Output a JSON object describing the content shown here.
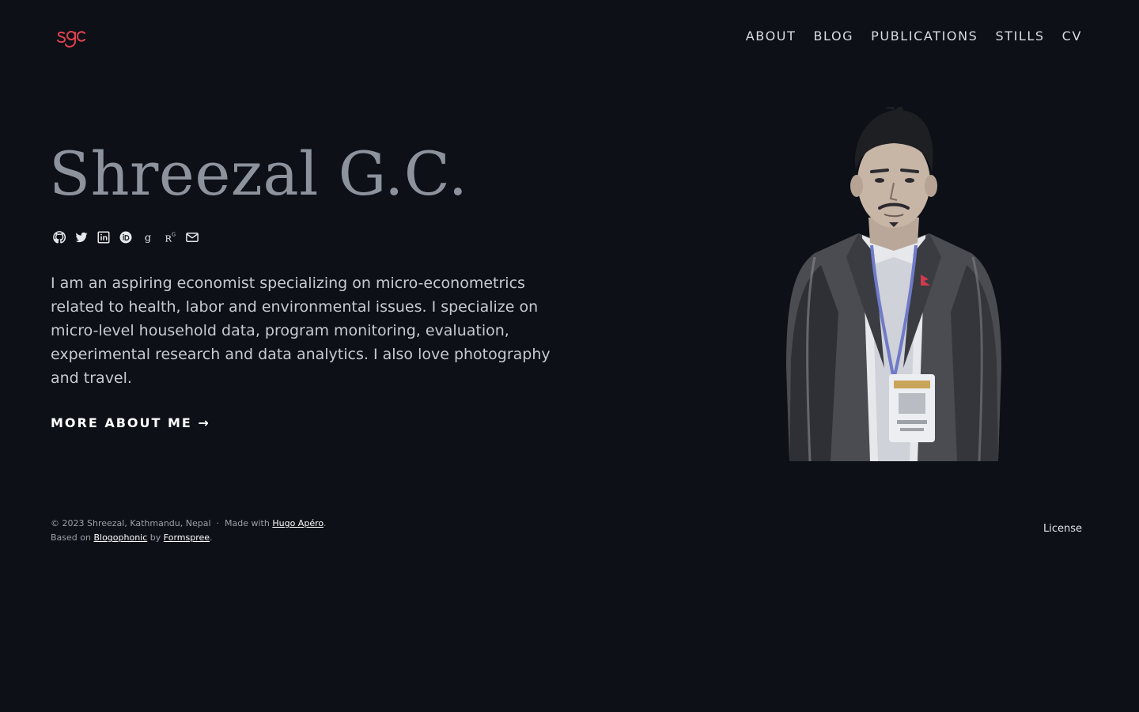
{
  "brand": {
    "logo_text": "sgc",
    "accent_color": "#e0424f"
  },
  "nav": {
    "items": [
      {
        "label": "ABOUT"
      },
      {
        "label": "BLOG"
      },
      {
        "label": "PUBLICATIONS"
      },
      {
        "label": "STILLS"
      },
      {
        "label": "CV"
      }
    ]
  },
  "hero": {
    "name": "Shreezal G.C.",
    "social_icons": [
      "github-icon",
      "twitter-icon",
      "linkedin-icon",
      "orcid-icon",
      "google-scholar-icon",
      "researchgate-icon",
      "email-icon"
    ],
    "bio": "I am an aspiring economist specializing on micro-econometrics related to health, labor and environmental issues. I specialize on micro-level household data, program monitoring, evaluation, experimental research and data analytics. I also love photography and travel.",
    "more_link": "MORE ABOUT ME →"
  },
  "footer": {
    "copyright": "© 2023 Shreezal, Kathmandu, Nepal",
    "separator": "·",
    "made_with": "Made with",
    "made_with_link": "Hugo Apéro",
    "based_on": "Based on",
    "based_on_link": "Blogophonic",
    "by": "by",
    "by_link": "Formspree",
    "period": ".",
    "license": "License"
  },
  "colors": {
    "background": "#0d1017",
    "name_text": "#8d939d",
    "body_text": "#c7cbd1"
  }
}
